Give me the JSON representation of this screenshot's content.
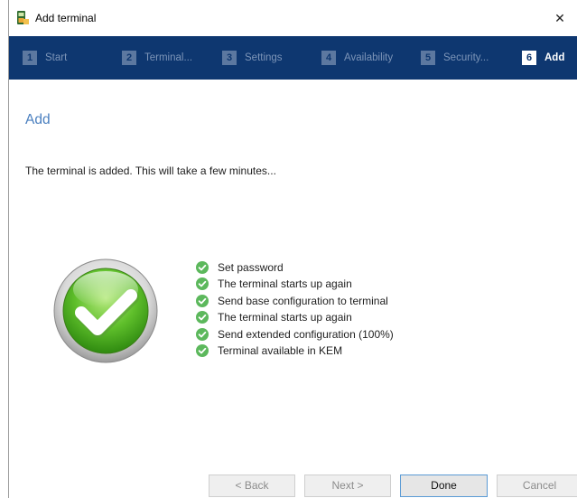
{
  "window": {
    "title": "Add terminal",
    "close_glyph": "✕",
    "icon": "terminal-app-icon"
  },
  "steps": [
    {
      "num": "1",
      "label": "Start",
      "active": false
    },
    {
      "num": "2",
      "label": "Terminal...",
      "active": false
    },
    {
      "num": "3",
      "label": "Settings",
      "active": false
    },
    {
      "num": "4",
      "label": "Availability",
      "active": false
    },
    {
      "num": "5",
      "label": "Security...",
      "active": false
    },
    {
      "num": "6",
      "label": "Add",
      "active": true
    }
  ],
  "content": {
    "heading": "Add",
    "message": "The terminal is added. This will take a few minutes...",
    "tasks": [
      {
        "label": "Set password",
        "status": "done"
      },
      {
        "label": "The terminal starts up again",
        "status": "done"
      },
      {
        "label": "Send base configuration to terminal",
        "status": "done"
      },
      {
        "label": "The terminal starts up again",
        "status": "done"
      },
      {
        "label": "Send extended configuration (100%)",
        "status": "done"
      },
      {
        "label": "Terminal available in KEM",
        "status": "done"
      }
    ]
  },
  "footer": {
    "back": "< Back",
    "next": "Next >",
    "done": "Done",
    "cancel": "Cancel"
  },
  "colors": {
    "header_bg": "#0e3770",
    "heading": "#4a7fbf",
    "success": "#5cb85c"
  }
}
